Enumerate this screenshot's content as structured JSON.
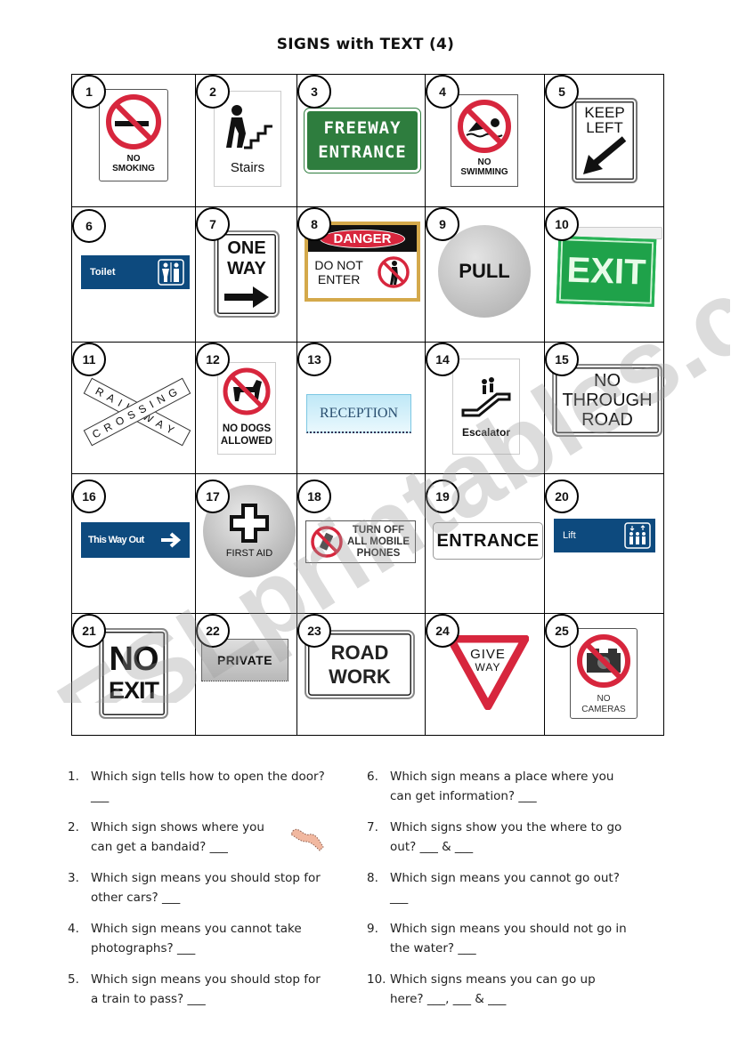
{
  "title": "SIGNS with TEXT (4)",
  "watermark": "ESLprintables.com",
  "signs": [
    {
      "n": "1",
      "lines": [
        "NO",
        "SMOKING"
      ],
      "icon": "no-smoking-icon"
    },
    {
      "n": "2",
      "lines": [
        "Stairs"
      ],
      "icon": "stairs-icon"
    },
    {
      "n": "3",
      "lines": [
        "FREEWAY",
        "ENTRANCE"
      ],
      "color": "#2e7d3e"
    },
    {
      "n": "4",
      "lines": [
        "NO",
        "SWIMMING"
      ],
      "icon": "no-swimming-icon"
    },
    {
      "n": "5",
      "lines": [
        "KEEP",
        "LEFT"
      ],
      "icon": "arrow-down-left-icon"
    },
    {
      "n": "6",
      "lines": [
        "Toilet"
      ],
      "icon": "toilet-icon",
      "color": "#0d4a7e"
    },
    {
      "n": "7",
      "lines": [
        "ONE",
        "WAY"
      ],
      "icon": "arrow-right-icon"
    },
    {
      "n": "8",
      "lines": [
        "DANGER",
        "DO NOT",
        "ENTER"
      ],
      "icon": "no-entry-person-icon"
    },
    {
      "n": "9",
      "lines": [
        "PULL"
      ]
    },
    {
      "n": "10",
      "lines": [
        "EXIT"
      ],
      "color": "#1fa24a"
    },
    {
      "n": "11",
      "lines": [
        "RAIL",
        "WAY",
        "CROSSING"
      ]
    },
    {
      "n": "12",
      "lines": [
        "NO DOGS",
        "ALLOWED"
      ],
      "icon": "no-dogs-icon"
    },
    {
      "n": "13",
      "lines": [
        "RECEPTION"
      ]
    },
    {
      "n": "14",
      "lines": [
        "Escalator"
      ],
      "icon": "escalator-icon"
    },
    {
      "n": "15",
      "lines": [
        "NO",
        "THROUGH",
        "ROAD"
      ]
    },
    {
      "n": "16",
      "lines": [
        "This Way Out"
      ],
      "icon": "arrow-right-icon",
      "color": "#0d4a7e"
    },
    {
      "n": "17",
      "lines": [
        "FIRST AID"
      ],
      "icon": "cross-icon"
    },
    {
      "n": "18",
      "lines": [
        "TURN OFF",
        "ALL MOBILE",
        "PHONES"
      ],
      "icon": "no-mobile-icon"
    },
    {
      "n": "19",
      "lines": [
        "ENTRANCE"
      ]
    },
    {
      "n": "20",
      "lines": [
        "Lift"
      ],
      "icon": "lift-icon",
      "color": "#0d4a7e"
    },
    {
      "n": "21",
      "lines": [
        "NO",
        "EXIT"
      ]
    },
    {
      "n": "22",
      "lines": [
        "PRIVATE"
      ]
    },
    {
      "n": "23",
      "lines": [
        "ROAD",
        "WORK"
      ]
    },
    {
      "n": "24",
      "lines": [
        "GIVE",
        "WAY"
      ]
    },
    {
      "n": "25",
      "lines": [
        "NO",
        "CAMERAS"
      ],
      "icon": "no-camera-icon"
    }
  ],
  "questions": [
    {
      "n": "1.",
      "text": "Which sign tells how to open the door?\n___"
    },
    {
      "n": "2.",
      "text": "Which sign shows where you\ncan get a bandaid?  ___"
    },
    {
      "n": "3.",
      "text": "Which sign means you should stop for\nother cars? ___"
    },
    {
      "n": "4.",
      "text": "Which sign means you cannot take\nphotographs? ___"
    },
    {
      "n": "5.",
      "text": "Which sign means you should stop for\na train to pass? ___"
    },
    {
      "n": "6.",
      "text": "Which sign means a place where you\ncan get information? ___"
    },
    {
      "n": "7.",
      "text": "Which signs show you the where to go\nout? ___ & ___"
    },
    {
      "n": "8.",
      "text": "Which sign means you cannot go out?\n___"
    },
    {
      "n": "9.",
      "text": "Which sign means you should not go in\nthe water? ___"
    },
    {
      "n": "10.",
      "text": "Which signs means you can go up\nhere? ___, ___ & ___"
    }
  ]
}
